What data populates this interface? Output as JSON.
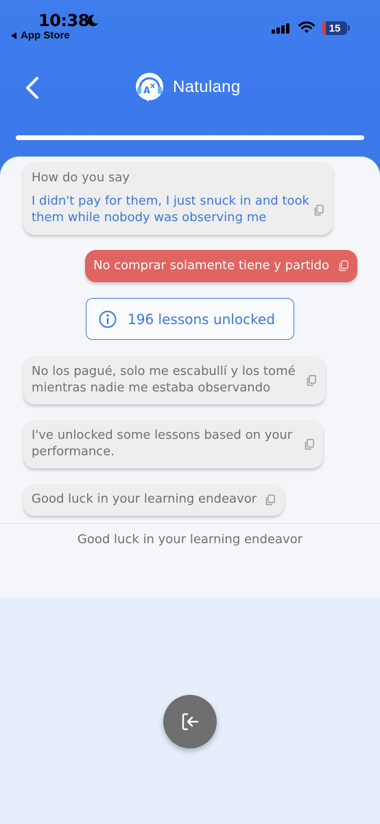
{
  "status_bar": {
    "time": "10:38",
    "back_app": "App Store",
    "battery": "15",
    "icons": [
      "moon-icon",
      "cellular-signal-icon",
      "wifi-icon",
      "battery-icon"
    ]
  },
  "header": {
    "app_name": "Natulang",
    "progress": 1.0,
    "icons": [
      "back-chevron-icon",
      "natulang-logo"
    ]
  },
  "chat": {
    "prompt_label": "How do you say",
    "prompt_phrase": "I didn't pay for them, I just snuck in and took them while nobody was observing me",
    "user_answer": "No comprar solamente tiene y partido",
    "lessons_unlocked": "196 lessons unlocked",
    "correct_translation": "No los pagué, solo me escabullí y los tomé mientras nadie me estaba observando",
    "unlock_message": "I've unlocked some lessons based on your performance.",
    "farewell": "Good luck in your learning endeavor"
  },
  "footer": {
    "text": "Good luck in your learning endeavor",
    "exit_icon": "exit-icon"
  },
  "colors": {
    "header_blue": "#3f7cec",
    "accent_blue": "#3d78d8",
    "answer_red": "#e06461",
    "bubble_gray": "#eeeeee",
    "exit_gray": "#6f6f6f"
  }
}
